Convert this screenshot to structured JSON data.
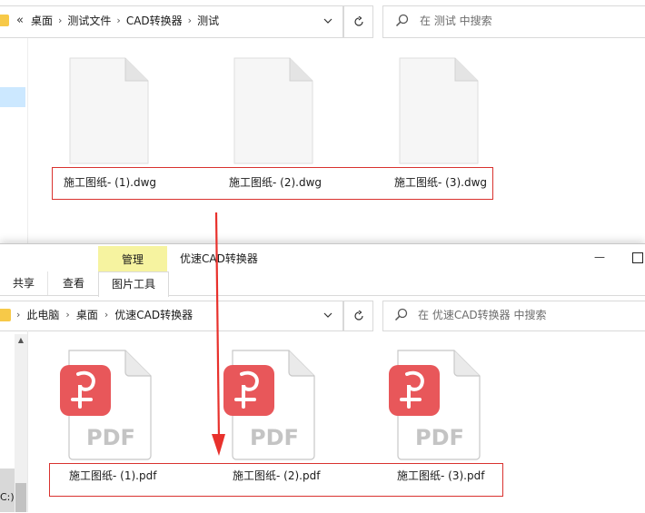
{
  "top_window": {
    "breadcrumb_overflow": "«",
    "breadcrumb": [
      "桌面",
      "测试文件",
      "CAD转换器",
      "测试"
    ],
    "search_placeholder": "在 测试 中搜索",
    "files": [
      {
        "name": "施工图纸- (1).dwg"
      },
      {
        "name": "施工图纸- (2).dwg"
      },
      {
        "name": "施工图纸- (3).dwg"
      }
    ]
  },
  "bottom_window": {
    "ribbon": {
      "context_tab": "管理",
      "title": "优速CAD转换器",
      "tabs": [
        "共享",
        "查看",
        "图片工具"
      ],
      "minimize": "—"
    },
    "breadcrumb": [
      "此电脑",
      "桌面",
      "优速CAD转换器"
    ],
    "search_placeholder": "在 优速CAD转换器 中搜索",
    "nav_partial_item": "C:)",
    "files": [
      {
        "name": "施工图纸- (1).pdf",
        "badge": "PDF"
      },
      {
        "name": "施工图纸- (2).pdf",
        "badge": "PDF"
      },
      {
        "name": "施工图纸- (3).pdf",
        "badge": "PDF"
      }
    ]
  },
  "colors": {
    "highlight_box": "#d9322f",
    "arrow": "#e8312c",
    "pdf_badge": "#e8575a",
    "manage_tab": "#f6f3a0"
  }
}
